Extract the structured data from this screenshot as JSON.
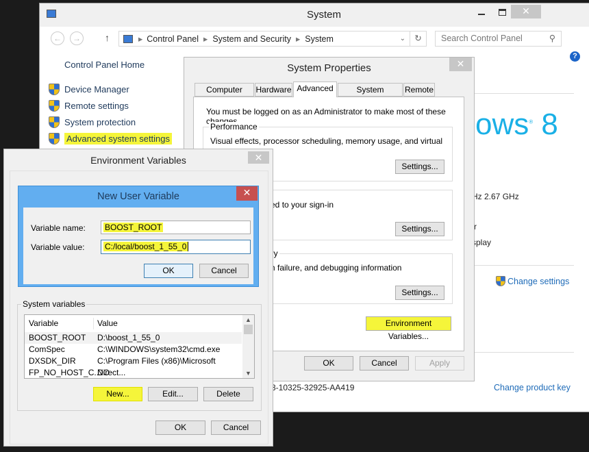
{
  "system_window": {
    "title": "System",
    "breadcrumb": [
      "Control Panel",
      "System and Security",
      "System"
    ],
    "search_placeholder": "Search Control Panel",
    "nav": {
      "home": "Control Panel Home",
      "items": [
        "Device Manager",
        "Remote settings",
        "System protection",
        "Advanced system settings"
      ]
    },
    "logo_text": "ows",
    "logo_number": "8",
    "processor_fragment": "Hz   2.67 GHz",
    "fragment_r": "r",
    "fragment_display": "splay",
    "change_settings": "Change settings",
    "product_id_fragment": "3-10325-32925-AA419",
    "change_product_key": "Change product key",
    "accent_color": "#1ab0e6"
  },
  "system_properties": {
    "title": "System Properties",
    "tabs": [
      "Computer Name",
      "Hardware",
      "Advanced",
      "System Protection",
      "Remote"
    ],
    "active_tab": "Advanced",
    "admin_note": "You must be logged on as an Administrator to make most of these changes.",
    "performance": {
      "label": "Performance",
      "desc": "Visual effects, processor scheduling, memory usage, and virtual memory",
      "button": "Settings..."
    },
    "profiles": {
      "desc": "ated to your sign-in",
      "button": "Settings..."
    },
    "startup": {
      "label": "ery",
      "desc": "em failure, and debugging information",
      "button": "Settings..."
    },
    "env_button": "Environment Variables...",
    "ok": "OK",
    "cancel": "Cancel",
    "apply": "Apply"
  },
  "env_vars": {
    "title": "Environment Variables",
    "system_label": "System variables",
    "columns": [
      "Variable",
      "Value"
    ],
    "rows": [
      [
        "BOOST_ROOT",
        "D:\\boost_1_55_0"
      ],
      [
        "ComSpec",
        "C:\\WINDOWS\\system32\\cmd.exe"
      ],
      [
        "DXSDK_DIR",
        "C:\\Program Files (x86)\\Microsoft Direct..."
      ],
      [
        "FP_NO_HOST_C...",
        "NO"
      ]
    ],
    "new": "New...",
    "edit": "Edit...",
    "delete": "Delete",
    "ok": "OK",
    "cancel": "Cancel"
  },
  "new_user_var": {
    "title": "New User Variable",
    "name_label": "Variable name:",
    "name_value": "BOOST_ROOT",
    "value_label": "Variable value:",
    "value_value": "C:/local/boost_1_55_0",
    "ok": "OK",
    "cancel": "Cancel"
  },
  "highlight_color": "#f5f53a"
}
